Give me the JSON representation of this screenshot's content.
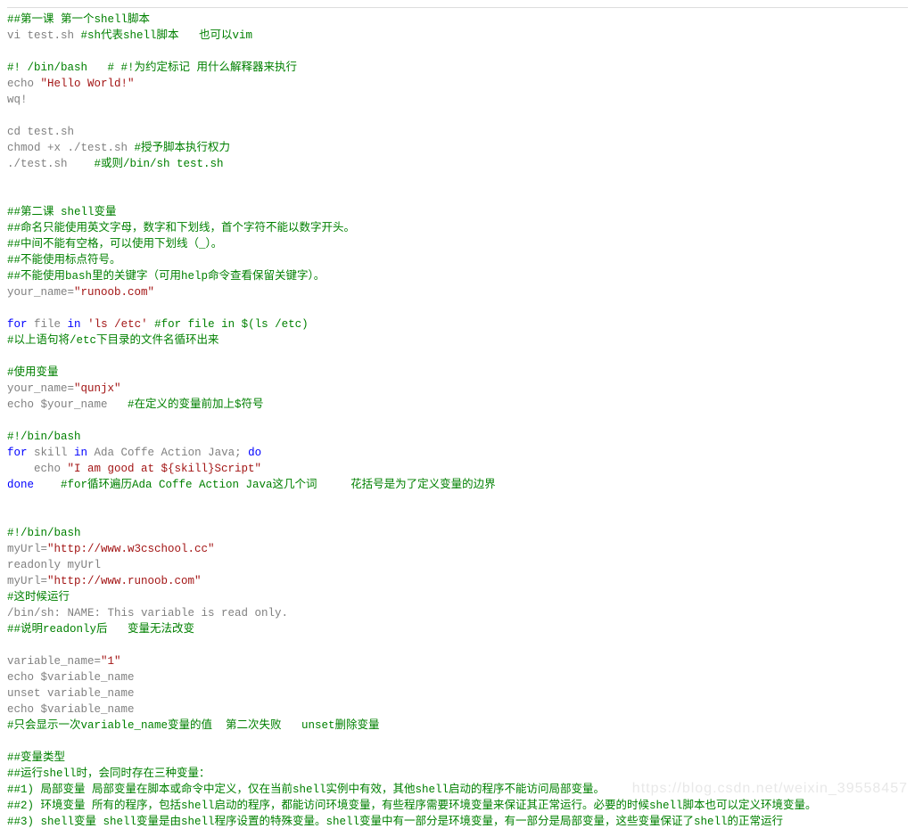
{
  "lines": [
    [
      [
        "c-comment",
        "##第一课 第一个shell脚本"
      ]
    ],
    [
      [
        "",
        "vi test.sh "
      ],
      [
        "c-comment",
        "#sh代表shell脚本   也可以vim"
      ]
    ],
    [],
    [
      [
        "c-comment",
        "#! /bin/bash   # #!为约定标记 用什么解释器来执行"
      ]
    ],
    [
      [
        "",
        "echo "
      ],
      [
        "c-str",
        "\"Hello World!\""
      ]
    ],
    [
      [
        "",
        "wq!"
      ]
    ],
    [],
    [
      [
        "",
        "cd test.sh"
      ]
    ],
    [
      [
        "",
        "chmod +x ./test.sh "
      ],
      [
        "c-comment",
        "#授予脚本执行权力"
      ]
    ],
    [
      [
        "",
        "./test.sh    "
      ],
      [
        "c-comment",
        "#或则/bin/sh test.sh"
      ]
    ],
    [],
    [],
    [
      [
        "c-comment",
        "##第二课 shell变量"
      ]
    ],
    [
      [
        "c-comment",
        "##命名只能使用英文字母，数字和下划线，首个字符不能以数字开头。"
      ]
    ],
    [
      [
        "c-comment",
        "##中间不能有空格，可以使用下划线（_）。"
      ]
    ],
    [
      [
        "c-comment",
        "##不能使用标点符号。"
      ]
    ],
    [
      [
        "c-comment",
        "##不能使用bash里的关键字（可用help命令查看保留关键字）。"
      ]
    ],
    [
      [
        "",
        "your_name="
      ],
      [
        "c-str",
        "\"runoob.com\""
      ]
    ],
    [],
    [
      [
        "c-keyword",
        "for"
      ],
      [
        "",
        " file "
      ],
      [
        "c-keyword",
        "in"
      ],
      [
        "",
        " "
      ],
      [
        "c-str",
        "'ls /etc'"
      ],
      [
        "",
        " "
      ],
      [
        "c-comment",
        "#for file in $(ls /etc)"
      ]
    ],
    [
      [
        "c-comment",
        "#以上语句将/etc下目录的文件名循环出来"
      ]
    ],
    [],
    [
      [
        "c-comment",
        "#使用变量"
      ]
    ],
    [
      [
        "",
        "your_name="
      ],
      [
        "c-str",
        "\"qunjx\""
      ]
    ],
    [
      [
        "",
        "echo $your_name   "
      ],
      [
        "c-comment",
        "#在定义的变量前加上$符号"
      ]
    ],
    [],
    [
      [
        "c-comment",
        "#!/bin/bash"
      ]
    ],
    [
      [
        "c-keyword",
        "for"
      ],
      [
        "",
        " skill "
      ],
      [
        "c-keyword",
        "in"
      ],
      [
        "",
        " Ada Coffe Action Java; "
      ],
      [
        "c-keyword",
        "do"
      ]
    ],
    [
      [
        "",
        "    echo "
      ],
      [
        "c-str",
        "\"I am good at ${skill}Script\""
      ]
    ],
    [
      [
        "c-keyword",
        "done"
      ],
      [
        "",
        "    "
      ],
      [
        "c-comment",
        "#for循环遍历Ada Coffe Action Java这几个词     花括号是为了定义变量的边界"
      ]
    ],
    [],
    [],
    [
      [
        "c-comment",
        "#!/bin/bash"
      ]
    ],
    [
      [
        "",
        "myUrl="
      ],
      [
        "c-str",
        "\"http://www.w3cschool.cc\""
      ]
    ],
    [
      [
        "",
        "readonly myUrl"
      ]
    ],
    [
      [
        "",
        "myUrl="
      ],
      [
        "c-str",
        "\"http://www.runoob.com\""
      ]
    ],
    [
      [
        "c-comment",
        "#这时候运行"
      ]
    ],
    [
      [
        "",
        "/bin/sh: NAME: This variable is read only."
      ]
    ],
    [
      [
        "c-comment",
        "##说明readonly后   变量无法改变"
      ]
    ],
    [],
    [
      [
        "",
        "variable_name="
      ],
      [
        "c-str",
        "\"1\""
      ]
    ],
    [
      [
        "",
        "echo $variable_name"
      ]
    ],
    [
      [
        "",
        "unset variable_name"
      ]
    ],
    [
      [
        "",
        "echo $variable_name"
      ]
    ],
    [
      [
        "c-comment",
        "#只会显示一次variable_name变量的值  第二次失败   unset删除变量"
      ]
    ],
    [],
    [
      [
        "c-comment",
        "##变量类型"
      ]
    ],
    [
      [
        "c-comment",
        "##运行shell时，会同时存在三种变量："
      ]
    ],
    [
      [
        "c-comment",
        "##1) 局部变量 局部变量在脚本或命令中定义，仅在当前shell实例中有效，其他shell启动的程序不能访问局部变量。"
      ]
    ],
    [
      [
        "c-comment",
        "##2) 环境变量 所有的程序，包括shell启动的程序，都能访问环境变量，有些程序需要环境变量来保证其正常运行。必要的时候shell脚本也可以定义环境变量。"
      ]
    ],
    [
      [
        "c-comment",
        "##3) shell变量 shell变量是由shell程序设置的特殊变量。shell变量中有一部分是环境变量，有一部分是局部变量，这些变量保证了shell的正常运行"
      ]
    ]
  ],
  "watermark": "https://blog.csdn.net/weixin_39558457"
}
